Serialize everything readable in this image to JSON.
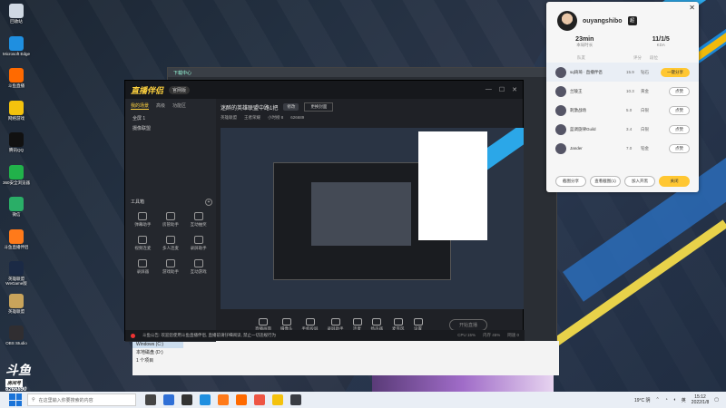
{
  "desktop_icons": [
    {
      "label": "回收站",
      "color": "#cfd8e3"
    },
    {
      "label": "Microsoft Edge",
      "color": "#1f8fe0"
    },
    {
      "label": "斗鱼直播",
      "color": "#ff6a00"
    },
    {
      "label": "网络游戏",
      "color": "#f4c20d"
    },
    {
      "label": "腾讯QQ",
      "color": "#111111"
    },
    {
      "label": "360安全浏览器",
      "color": "#21b24a"
    },
    {
      "label": "微信",
      "color": "#2aae67"
    },
    {
      "label": "斗鱼直播伴侣",
      "color": "#ff7a1a"
    },
    {
      "label": "英雄联盟 WeGame版",
      "color": "#1b2a45"
    },
    {
      "label": "英雄联盟",
      "color": "#c9a45b"
    },
    {
      "label": "OBS Studio",
      "color": "#302e31"
    }
  ],
  "back_window": {
    "bar_text": "下载中心"
  },
  "file_panel": {
    "items": [
      "Windows (C:)",
      "本地磁盘 (D:)"
    ],
    "count": "1 个项目"
  },
  "main_window": {
    "logo": "直播伴侣",
    "version": "官网版",
    "left_tabs": [
      "我的场景",
      "高级",
      "功能区"
    ],
    "scenes": [
      "全屏 1",
      "摄像联盟"
    ],
    "tools_header": "工具箱",
    "tools": [
      "弹幕助手",
      "房管助手",
      "互动抽奖",
      "视频连麦",
      "多人连麦",
      "录屏助手",
      "录屏器",
      "游戏助手",
      "互动游戏"
    ],
    "room_title": "迷醉的英雄联盟中路1把",
    "room_edit": "修改",
    "room_button": "更换封面",
    "room_meta": [
      "英雄联盟",
      "王者荣耀",
      "小时榜 8",
      "626689"
    ],
    "bottom_tools": [
      "直播画面",
      "摄像头",
      "手机投屏",
      "录屏助手",
      "连麦",
      "扬声器",
      "麦克风",
      "设置"
    ],
    "go_live": "开始直播",
    "notice": "斗鱼公告: 欢迎您使用斗鱼直播伴侣, 直播前请仔细阅读, 禁止一切违规行为",
    "status": [
      "CPU 15%",
      "内存 45%",
      "网速 0"
    ]
  },
  "popup": {
    "username": "ouyangshibo",
    "badge": "超",
    "stats": [
      {
        "value": "23min",
        "label": "本局时长"
      },
      {
        "value": "11/1/5",
        "label": "KDA"
      }
    ],
    "columns": [
      "队友",
      "评分",
      "段位"
    ],
    "players": [
      {
        "name": "sq琦琦 · 直播伴侣",
        "score": "15.9",
        "rank": "钻石",
        "action": "一键分享",
        "highlight": true
      },
      {
        "name": "兰陵王",
        "score": "10.3",
        "rank": "黄金",
        "action": "点赞",
        "highlight": false
      },
      {
        "name": "刺激战场",
        "score": "5.0",
        "rank": "白银",
        "action": "点赞",
        "highlight": false
      },
      {
        "name": "蓝调旋律Guild",
        "score": "3.4",
        "rank": "白银",
        "action": "点赞",
        "highlight": false
      },
      {
        "name": "Jander",
        "score": "7.0",
        "rank": "铂金",
        "action": "点赞",
        "highlight": false
      }
    ],
    "footer_buttons": [
      "截图分享",
      "查看截图(1)",
      "加入开黑",
      "关闭"
    ]
  },
  "overlay": {
    "logo": "斗鱼",
    "room_label": "房间号",
    "room_no": "6266890"
  },
  "taskbar": {
    "search_placeholder": "在这里输入你要搜索的内容",
    "weather": "19°C 阴",
    "time": "15:12",
    "date": "2022/1/8",
    "lang": "英"
  }
}
